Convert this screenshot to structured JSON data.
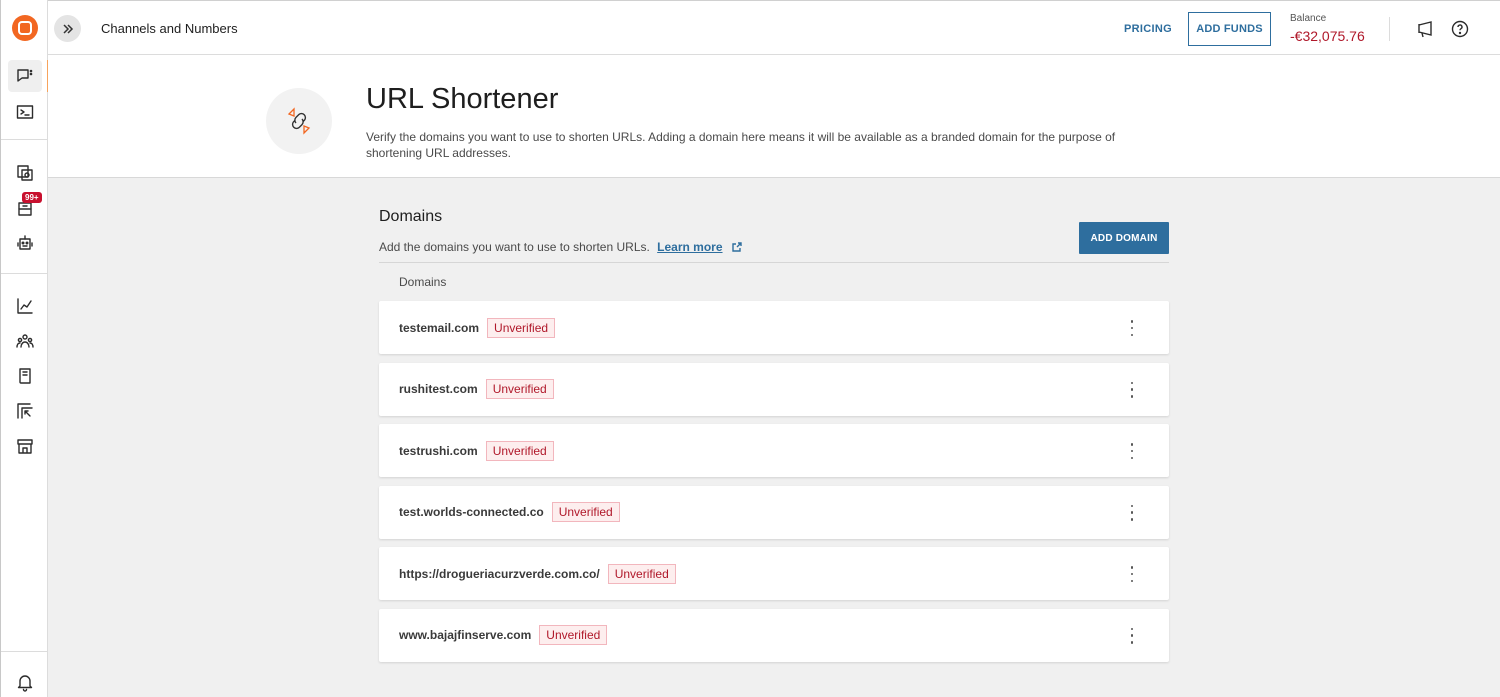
{
  "app": {
    "title": "Channels and Numbers"
  },
  "rail": {
    "notifications_badge": "99+",
    "items": [
      {
        "icon": "chat-icon"
      },
      {
        "icon": "terminal-icon"
      },
      {
        "icon": "copy-search-icon"
      },
      {
        "icon": "inbox-icon"
      },
      {
        "icon": "bot-icon"
      },
      {
        "icon": "chart-icon"
      },
      {
        "icon": "people-icon"
      },
      {
        "icon": "book-icon"
      },
      {
        "icon": "cursor-box-icon"
      },
      {
        "icon": "store-icon"
      },
      {
        "icon": "bell-icon"
      }
    ]
  },
  "topbar": {
    "pricing_label": "PRICING",
    "add_funds_label": "ADD FUNDS",
    "balance_label": "Balance",
    "balance_value": "-€32,075.76"
  },
  "header": {
    "title": "URL Shortener",
    "description": "Verify the domains you want to use to shorten URLs. Adding a domain here means it will be available as a branded domain for the purpose of shortening URL addresses."
  },
  "domains_section": {
    "title": "Domains",
    "description": "Add the domains you want to use to shorten URLs.",
    "learn_more": "Learn more",
    "add_domain_label": "ADD DOMAIN",
    "column_header": "Domains",
    "rows": [
      {
        "domain": "testemail.com",
        "status": "Unverified"
      },
      {
        "domain": "rushitest.com",
        "status": "Unverified"
      },
      {
        "domain": "testrushi.com",
        "status": "Unverified"
      },
      {
        "domain": "test.worlds-connected.co",
        "status": "Unverified"
      },
      {
        "domain": "https://drogueriacurzverde.com.co/",
        "status": "Unverified"
      },
      {
        "domain": "www.bajajfinserve.com",
        "status": "Unverified"
      }
    ]
  },
  "colors": {
    "brand_orange": "#f26722",
    "accent_blue": "#2e6e9e",
    "error_red": "#b0182a"
  }
}
